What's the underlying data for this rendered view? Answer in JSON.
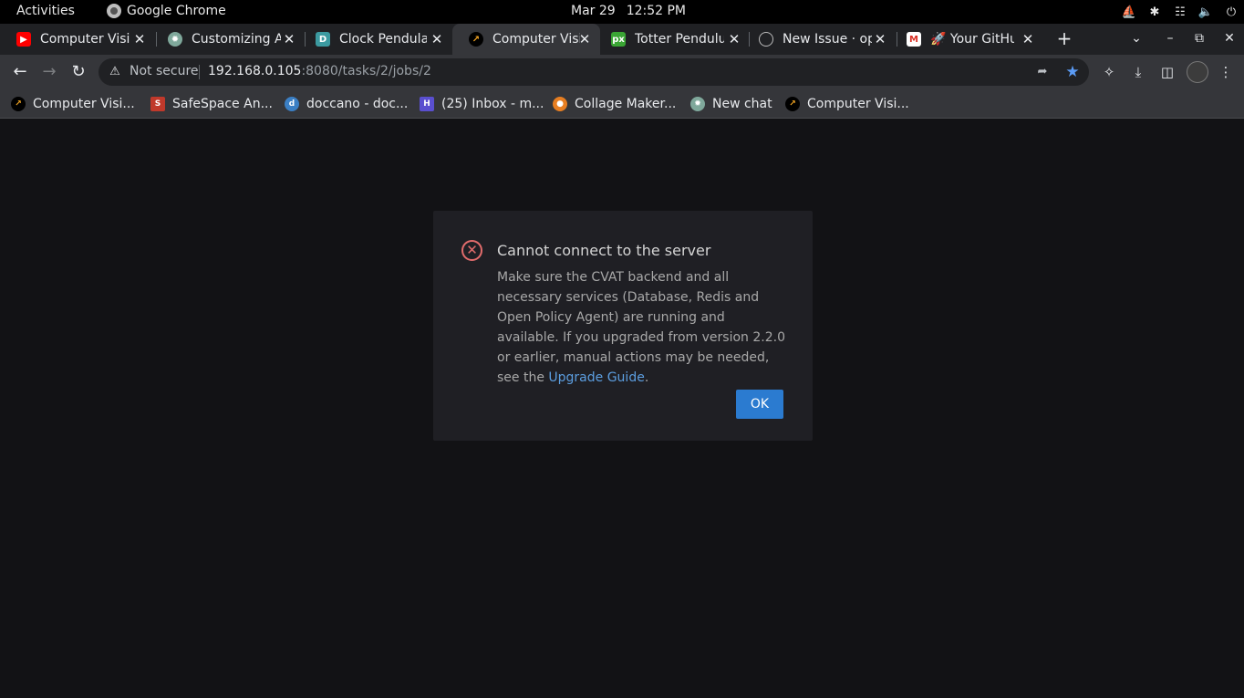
{
  "os_bar": {
    "activities": "Activities",
    "app_name": "Google Chrome",
    "date": "Mar 29",
    "time": "12:52 PM"
  },
  "tabs": [
    {
      "title": "Computer Visi",
      "favicon": "youtube-icon"
    },
    {
      "title": "Customizing A",
      "favicon": "chatgpt-icon"
    },
    {
      "title": "Clock Pendula",
      "favicon": "doccano-icon"
    },
    {
      "title": "Computer Visi",
      "favicon": "cvat-icon",
      "active": true
    },
    {
      "title": "Totter Pendulu",
      "favicon": "px-icon"
    },
    {
      "title": "New Issue · op",
      "favicon": "github-icon"
    },
    {
      "title": "🚀 Your GitHu",
      "favicon": "gmail-icon"
    }
  ],
  "toolbar": {
    "security_label": "Not secure",
    "url_host": "192.168.0.105",
    "url_rest": ":8080/tasks/2/jobs/2"
  },
  "bookmarks": [
    {
      "label": "Computer Visi...",
      "favicon": "cvat-icon"
    },
    {
      "label": "SafeSpace An...",
      "favicon": "safespace-icon"
    },
    {
      "label": "doccano - doc...",
      "favicon": "doccano-icon"
    },
    {
      "label": "(25) Inbox - m...",
      "favicon": "inbox-icon"
    },
    {
      "label": "Collage Maker...",
      "favicon": "collage-icon"
    },
    {
      "label": "New chat",
      "favicon": "chatgpt-icon"
    },
    {
      "label": "Computer Visi...",
      "favicon": "cvat-icon"
    }
  ],
  "dialog": {
    "title": "Cannot connect to the server",
    "body": "Make sure the CVAT backend and all necessary services (Database, Redis and Open Policy Agent) are running and available. If you upgraded from version 2.2.0 or earlier, manual actions may be needed, see the ",
    "link_text": "Upgrade Guide",
    "body_end": ".",
    "ok_label": "OK"
  },
  "colors": {
    "page_bg": "#121215",
    "dialog_bg": "#1f1f24",
    "error": "#e26c6c",
    "primary": "#2b7bd0",
    "link": "#5c9ee0"
  }
}
